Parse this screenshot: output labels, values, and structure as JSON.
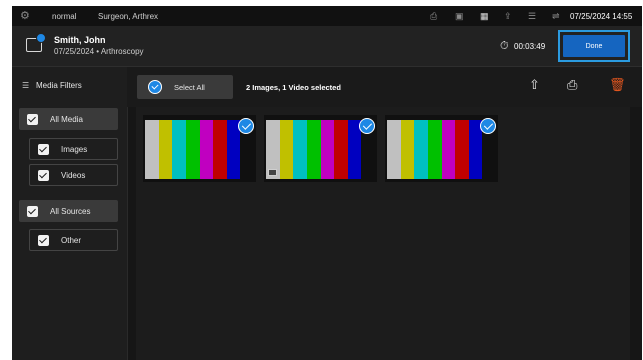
{
  "status_bar": {
    "gear_icon": "gear-icon",
    "profile": "normal",
    "user": "Surgeon, Arthrex",
    "datetime": "07/25/2024 14:55",
    "icons": [
      "printer-icon",
      "record-icon",
      "qr-icon",
      "export-icon",
      "storage-icon",
      "usb-icon"
    ]
  },
  "header": {
    "patient_name": "Smith, John",
    "patient_detail": "07/25/2024 • Arthroscopy",
    "timer": "00:03:49",
    "done_label": "Done"
  },
  "sidebar": {
    "title": "Media Filters",
    "media_group": {
      "label": "All Media",
      "checked": true,
      "items": [
        {
          "label": "Images",
          "checked": true
        },
        {
          "label": "Videos",
          "checked": true
        }
      ]
    },
    "source_group": {
      "label": "All Sources",
      "checked": true,
      "items": [
        {
          "label": "Other",
          "checked": true
        }
      ]
    }
  },
  "toolbar": {
    "select_all_label": "Select All",
    "selection_status": "2 Images, 1 Video selected",
    "actions": [
      "export-icon",
      "print-icon",
      "trash-icon"
    ]
  },
  "media": {
    "colors": {
      "accent": "#1e88e5",
      "delete": "#e2561f"
    },
    "color_bars": [
      "#c0c0c0",
      "#c0c000",
      "#00c0c0",
      "#00c000",
      "#c000c0",
      "#c00000",
      "#0000c0",
      "#101010"
    ],
    "items": [
      {
        "type": "image",
        "selected": true
      },
      {
        "type": "video",
        "selected": true
      },
      {
        "type": "image",
        "selected": true
      }
    ]
  }
}
